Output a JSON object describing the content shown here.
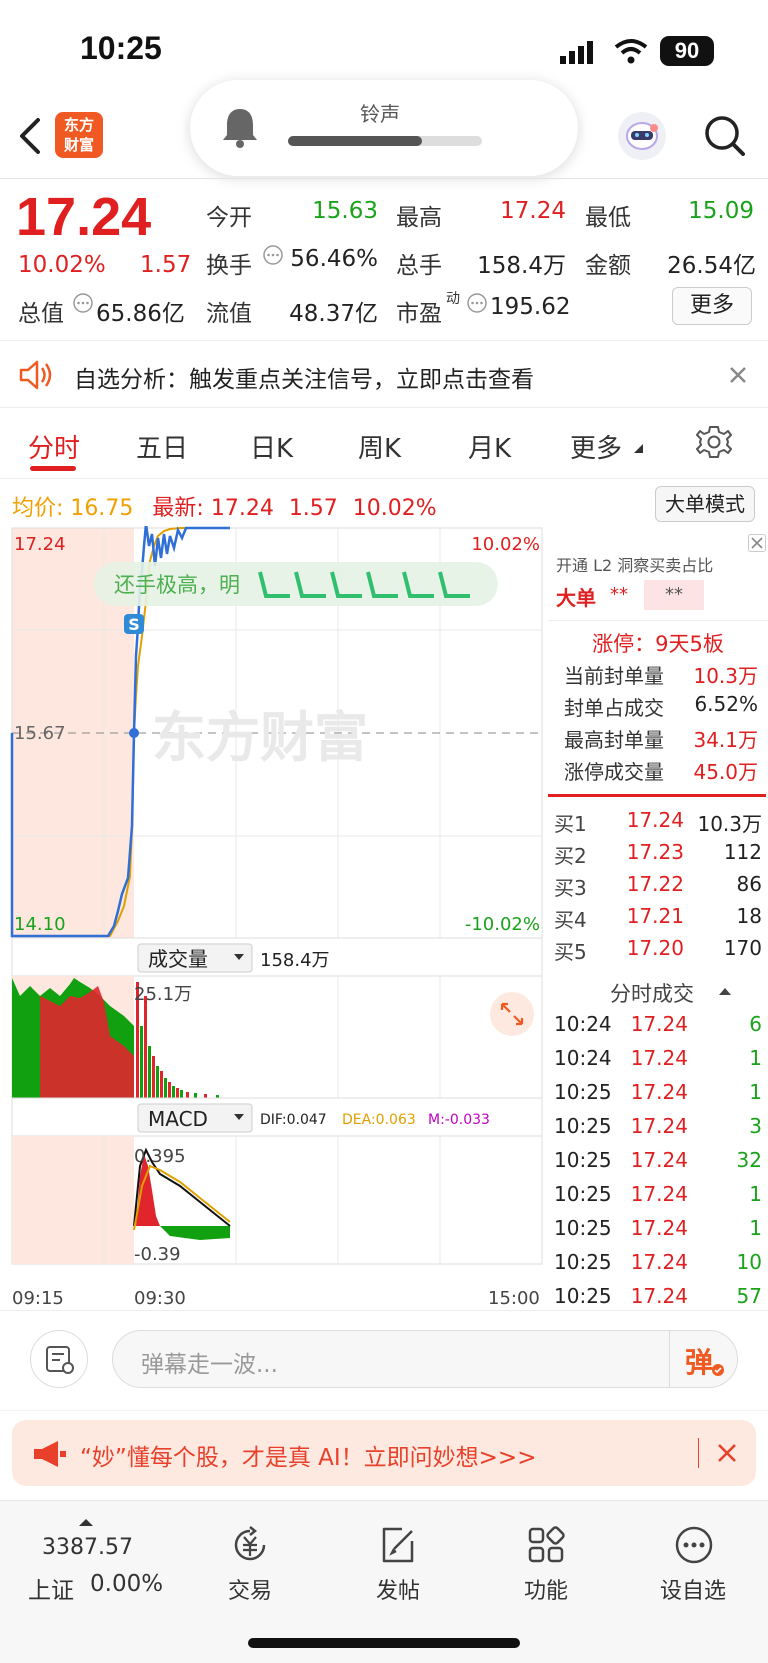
{
  "status": {
    "time": "10:25",
    "battery": "90"
  },
  "ringer": {
    "label": "铃声",
    "level": 0.69
  },
  "header": {
    "logo_text": "东方\n财富"
  },
  "quote": {
    "price": "17.24",
    "pct": "10.02%",
    "chg": "1.57",
    "open_label": "今开",
    "open": "15.63",
    "high_label": "最高",
    "high": "17.24",
    "low_label": "最低",
    "low": "15.09",
    "turnover_label": "换手",
    "turnover": "56.46%",
    "volume_label": "总手",
    "volume": "158.4万",
    "amount_label": "金额",
    "amount": "26.54亿",
    "mktcap_label": "总值",
    "mktcap": "65.86亿",
    "float_label": "流值",
    "float": "48.37亿",
    "pe_label": "市盈",
    "pe_sup": "动",
    "pe": "195.62",
    "more": "更多"
  },
  "banner": {
    "text": "自选分析：触发重点关注信号，立即点击查看"
  },
  "tabs": [
    "分时",
    "五日",
    "日K",
    "周K",
    "月K",
    "更多"
  ],
  "summary": {
    "avg_label": "均价:",
    "avg": "16.75",
    "latest_label": "最新:",
    "latest": "17.24",
    "chg": "1.57",
    "pct": "10.02%",
    "mode_btn": "大单模式"
  },
  "chart": {
    "y_top": "17.24",
    "y_mid": "15.67",
    "y_bot": "14.10",
    "pct_top": "10.02%",
    "pct_bot": "-10.02%",
    "watermark": "东方财富",
    "danmaku": "还手极高，明",
    "marker": "S",
    "volume_label": "成交量",
    "volume_total": "158.4万",
    "volume_max": "25.1万",
    "macd_label": "MACD",
    "dif": "DIF:0.047",
    "dea": "DEA:0.063",
    "m": "M:-0.033",
    "macd_top": "0.395",
    "macd_bot": "-0.39",
    "t_start": "09:15",
    "t_open": "09:30",
    "t_end": "15:00"
  },
  "right_panel": {
    "l2_text": "开通 L2 洞察买卖占比",
    "big_label": "大单",
    "big_a": "**",
    "big_b": "**",
    "limit_title": "涨停：9天5板",
    "rows": [
      {
        "label": "当前封单量",
        "value": "10.3万"
      },
      {
        "label": "封单占成交",
        "value": "6.52%"
      },
      {
        "label": "最高封单量",
        "value": "34.1万"
      },
      {
        "label": "涨停成交量",
        "value": "45.0万"
      }
    ],
    "bids": [
      {
        "name": "买1",
        "price": "17.24",
        "vol": "10.3万"
      },
      {
        "name": "买2",
        "price": "17.23",
        "vol": "112"
      },
      {
        "name": "买3",
        "price": "17.22",
        "vol": "86"
      },
      {
        "name": "买4",
        "price": "17.21",
        "vol": "18"
      },
      {
        "name": "买5",
        "price": "17.20",
        "vol": "170"
      }
    ],
    "trades_title": "分时成交",
    "trades": [
      {
        "t": "10:24",
        "p": "17.24",
        "v": "6"
      },
      {
        "t": "10:24",
        "p": "17.24",
        "v": "1"
      },
      {
        "t": "10:25",
        "p": "17.24",
        "v": "1"
      },
      {
        "t": "10:25",
        "p": "17.24",
        "v": "3"
      },
      {
        "t": "10:25",
        "p": "17.24",
        "v": "32"
      },
      {
        "t": "10:25",
        "p": "17.24",
        "v": "1"
      },
      {
        "t": "10:25",
        "p": "17.24",
        "v": "1"
      },
      {
        "t": "10:25",
        "p": "17.24",
        "v": "10"
      },
      {
        "t": "10:25",
        "p": "17.24",
        "v": "57"
      }
    ]
  },
  "danmu": {
    "placeholder": "弹幕走一波...",
    "send": "弹"
  },
  "promo": {
    "text": "“妙”懂每个股，才是真 AI！立即问妙想>>>"
  },
  "bottom": {
    "index_value": "3387.57",
    "index_name": "上证",
    "index_pct": "0.00%",
    "nav": [
      "交易",
      "发帖",
      "功能",
      "设自选"
    ]
  }
}
